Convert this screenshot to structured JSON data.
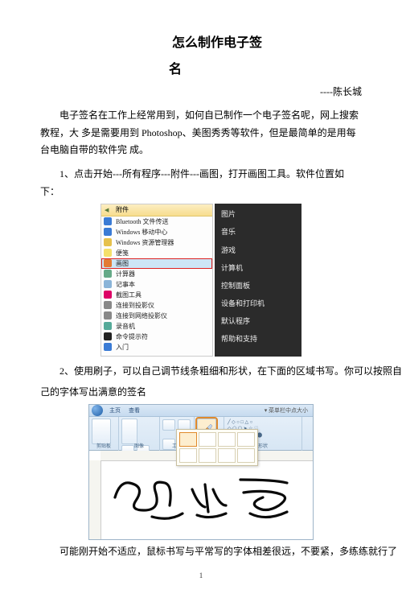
{
  "title_line1": "怎么制作电子签",
  "title_line2": "名",
  "author": "----陈长城",
  "intro": "电子签名在工作上经常用到，如何自已制作一个电子签名呢，网上搜索教程，大  多是需要用到 Photoshop、美图秀秀等软件，但是最简单的是用每台电脑自带的软件完  成。",
  "step1": "1、点击开始---所有程序---附件---画图，打开画图工具。软件位置如下：",
  "fig1": {
    "header": "附件",
    "left_items": [
      "Bluetooth 文件传送",
      "Windows 移动中心",
      "Windows 资源管理器",
      "便笺",
      "画图",
      "计算器",
      "记事本",
      "截图工具",
      "连接到投影仪",
      "连接到网络投影仪",
      "录音机",
      "命令提示符",
      "入门"
    ],
    "right_items": [
      "图片",
      "音乐",
      "游戏",
      "计算机",
      "控制面板",
      "设备和打印机",
      "默认程序",
      "帮助和支持"
    ]
  },
  "step2a": "2、使用刷子，可以自己调节线条粗细和形状，在下面的区域书写。你可以按照自",
  "step2b": "己的字体写出满意的签名",
  "fig2": {
    "tabs": [
      "主页",
      "查看"
    ],
    "groups": [
      "剪贴板",
      "图像",
      "工具",
      "刷子",
      "形状"
    ],
    "brush_label": "刷子",
    "menu_hint": "▾ 菜单栏中点大小"
  },
  "closing": "可能刚开始不适应，鼠标书写与平常写的字体相差很远，不要紧，多练练就行了",
  "page_number": "1"
}
